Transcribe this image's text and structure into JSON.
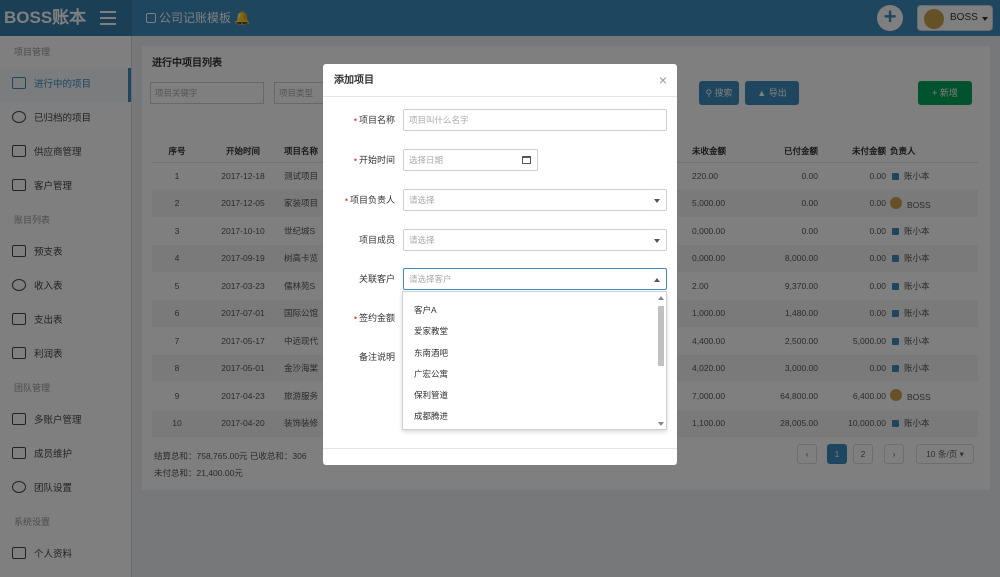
{
  "app": {
    "brand": "BOSS账本",
    "template_link": "公司记账模板",
    "user_name": "BOSS"
  },
  "sidebar": {
    "sections": [
      {
        "title": "项目管理",
        "items": [
          {
            "label": "进行中的项目",
            "icon": "layers-icon",
            "active": true
          },
          {
            "label": "已归档的项目",
            "icon": "check-circle-icon"
          },
          {
            "label": "供应商管理",
            "icon": "truck-icon"
          },
          {
            "label": "客户管理",
            "icon": "users-icon"
          }
        ]
      },
      {
        "title": "账目列表",
        "items": [
          {
            "label": "预支表",
            "icon": "ledger-icon"
          },
          {
            "label": "收入表",
            "icon": "database-icon"
          },
          {
            "label": "支出表",
            "icon": "doc-icon"
          },
          {
            "label": "利润表",
            "icon": "report-icon"
          }
        ]
      },
      {
        "title": "团队管理",
        "items": [
          {
            "label": "多账户管理",
            "icon": "accounts-icon"
          },
          {
            "label": "成员维护",
            "icon": "member-icon"
          },
          {
            "label": "团队设置",
            "icon": "team-settings-icon"
          }
        ]
      },
      {
        "title": "系统设置",
        "items": [
          {
            "label": "个人资料",
            "icon": "profile-icon"
          }
        ]
      }
    ]
  },
  "main": {
    "title": "进行中项目列表",
    "filters": {
      "keyword_placeholder": "项目关键字",
      "type_placeholder": "项目类型"
    },
    "buttons": {
      "search": "搜索",
      "export": "导出",
      "add": "新增"
    },
    "table": {
      "headers": [
        "序号",
        "开始时间",
        "项目名称",
        "未收金额",
        "已付金额",
        "未付金额",
        "负责人"
      ],
      "rows": [
        {
          "no": "1",
          "date": "2017-12-18",
          "name": "测试项目",
          "unreceived": "220.00",
          "paid": "0.00",
          "unpaid": "0.00",
          "owner": "账小本"
        },
        {
          "no": "2",
          "date": "2017-12-05",
          "name": "家装项目",
          "unreceived": "5,000.00",
          "paid": "0.00",
          "unpaid": "0.00",
          "owner": "BOSS"
        },
        {
          "no": "3",
          "date": "2017-10-10",
          "name": "世纪城S",
          "unreceived": "0,000.00",
          "paid": "0.00",
          "unpaid": "0.00",
          "owner": "账小本"
        },
        {
          "no": "4",
          "date": "2017-09-19",
          "name": "树高卡览",
          "unreceived": "0,000.00",
          "paid": "8,000.00",
          "unpaid": "0.00",
          "owner": "账小本"
        },
        {
          "no": "5",
          "date": "2017-03-23",
          "name": "儒林苑S",
          "unreceived": "2.00",
          "paid": "9,370.00",
          "unpaid": "0.00",
          "owner": "账小本"
        },
        {
          "no": "6",
          "date": "2017-07-01",
          "name": "国际公馆",
          "unreceived": "1,000.00",
          "paid": "1,480.00",
          "unpaid": "0.00",
          "owner": "账小本"
        },
        {
          "no": "7",
          "date": "2017-05-17",
          "name": "中远现代",
          "unreceived": "4,400.00",
          "paid": "2,500.00",
          "unpaid": "5,000.00",
          "owner": "账小本"
        },
        {
          "no": "8",
          "date": "2017-05-01",
          "name": "金沙海棠",
          "unreceived": "4,020.00",
          "paid": "3,000.00",
          "unpaid": "0.00",
          "owner": "账小本"
        },
        {
          "no": "9",
          "date": "2017-04-23",
          "name": "旅游服务",
          "unreceived": "7,000.00",
          "paid": "64,800.00",
          "unpaid": "6,400.00",
          "owner": "BOSS"
        },
        {
          "no": "10",
          "date": "2017-04-20",
          "name": "装饰装修",
          "unreceived": "1,100.00",
          "paid": "28,005.00",
          "unpaid": "10,000.00",
          "owner": "账小本"
        }
      ]
    },
    "summary": {
      "line1": "结算总和：758,765.00元  已收总和：306",
      "line2": "未付总和：21,400.00元"
    },
    "pagination": {
      "prev": "‹",
      "page1": "1",
      "page2": "2",
      "next": "›",
      "page_size": "10 条/页"
    }
  },
  "modal": {
    "title": "添加项目",
    "close": "×",
    "fields": {
      "name_label": "项目名称",
      "name_placeholder": "项目叫什么名字",
      "date_label": "开始时间",
      "date_placeholder": "选择日期",
      "owner_label": "项目负责人",
      "owner_placeholder": "请选择",
      "members_label": "项目成员",
      "members_placeholder": "请选择",
      "client_label": "关联客户",
      "client_placeholder": "请选择客户",
      "amount_label": "签约金额",
      "note_label": "备注说明"
    },
    "client_options": [
      "客户A",
      "爱家教堂",
      "东南酒吧",
      "广宏公寓",
      "保利管道",
      "成都腾进"
    ]
  },
  "colors": {
    "primary": "#3c8dbc",
    "success": "#00a65a",
    "required": "#dd4b39"
  }
}
